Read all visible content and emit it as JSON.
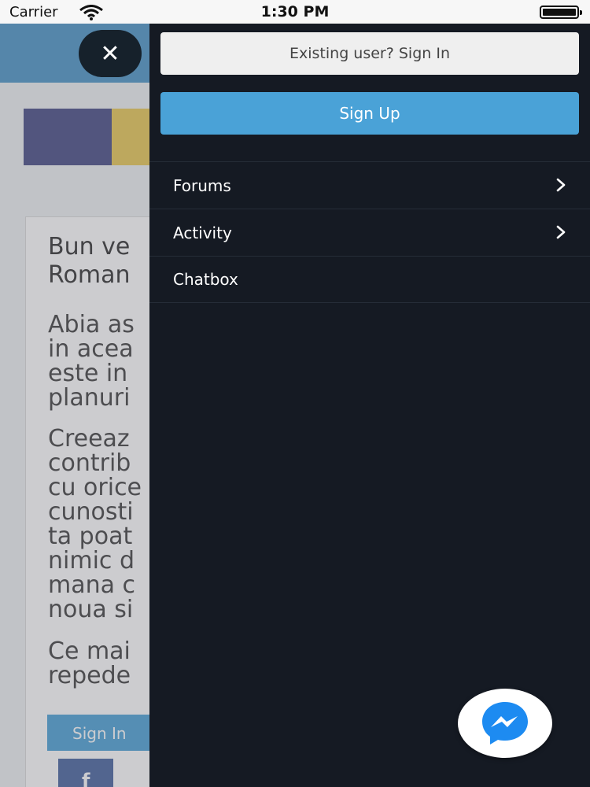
{
  "status_bar": {
    "carrier": "Carrier",
    "time": "1:30 PM"
  },
  "background_page": {
    "title": "Bun ve\nRoman",
    "paragraphs": [
      "Abia as\nin acea\neste in\nplanuri",
      "Creeaz\ncontrib\ncu orice\ncunosti\nta poat\nnimic d\nmana c\nnoua si",
      "Ce mai\nrepede"
    ],
    "sign_in_label": "Sign In",
    "facebook_glyph": "f"
  },
  "drawer": {
    "sign_in_label": "Existing user? Sign In",
    "sign_up_label": "Sign Up",
    "menu": [
      {
        "label": "Forums",
        "has_chevron": true
      },
      {
        "label": "Activity",
        "has_chevron": true
      },
      {
        "label": "Chatbox",
        "has_chevron": false
      }
    ]
  },
  "colors": {
    "header_blue": "#3f8fc4",
    "drawer_bg": "#151a23",
    "sign_up_blue": "#4aa2d7",
    "messenger_blue": "#1d8bf1"
  },
  "icons": [
    "wifi-icon",
    "battery-icon",
    "close-icon",
    "chevron-right-icon",
    "messenger-icon"
  ]
}
